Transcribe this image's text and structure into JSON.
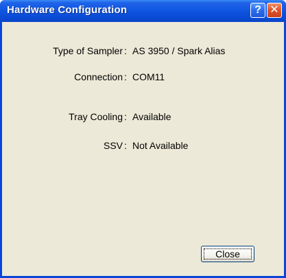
{
  "window": {
    "title": "Hardware Configuration",
    "help_glyph": "?",
    "close_glyph": "✕"
  },
  "fields": [
    {
      "label": "Type of Sampler",
      "value": "AS 3950 / Spark Alias"
    },
    {
      "label": "Connection",
      "value": "COM11"
    },
    {
      "label": "Tray Cooling",
      "value": "Available"
    },
    {
      "label": "SSV",
      "value": "Not Available"
    }
  ],
  "colon": ":",
  "buttons": {
    "close_label": "Close"
  },
  "colors": {
    "titlebar": "#0a4bd5",
    "client_background": "#ece9d8",
    "close_button_red": "#e0562d"
  }
}
